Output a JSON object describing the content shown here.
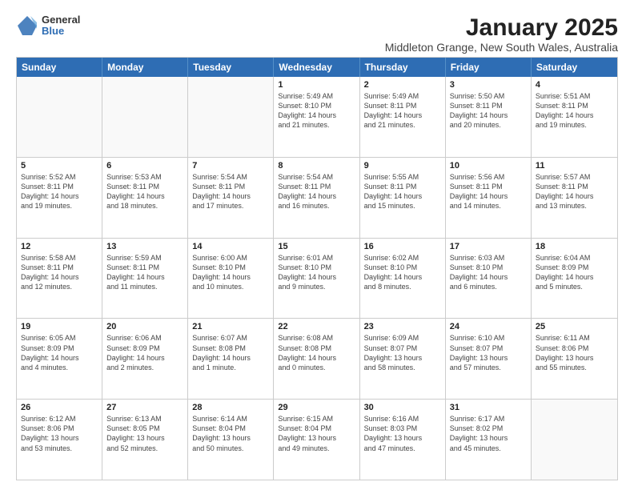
{
  "header": {
    "logo": {
      "general": "General",
      "blue": "Blue"
    },
    "title": "January 2025",
    "subtitle": "Middleton Grange, New South Wales, Australia"
  },
  "weekdays": [
    "Sunday",
    "Monday",
    "Tuesday",
    "Wednesday",
    "Thursday",
    "Friday",
    "Saturday"
  ],
  "rows": [
    [
      {
        "day": "",
        "info": "",
        "empty": true
      },
      {
        "day": "",
        "info": "",
        "empty": true
      },
      {
        "day": "",
        "info": "",
        "empty": true
      },
      {
        "day": "1",
        "info": "Sunrise: 5:49 AM\nSunset: 8:10 PM\nDaylight: 14 hours\nand 21 minutes."
      },
      {
        "day": "2",
        "info": "Sunrise: 5:49 AM\nSunset: 8:11 PM\nDaylight: 14 hours\nand 21 minutes."
      },
      {
        "day": "3",
        "info": "Sunrise: 5:50 AM\nSunset: 8:11 PM\nDaylight: 14 hours\nand 20 minutes."
      },
      {
        "day": "4",
        "info": "Sunrise: 5:51 AM\nSunset: 8:11 PM\nDaylight: 14 hours\nand 19 minutes."
      }
    ],
    [
      {
        "day": "5",
        "info": "Sunrise: 5:52 AM\nSunset: 8:11 PM\nDaylight: 14 hours\nand 19 minutes."
      },
      {
        "day": "6",
        "info": "Sunrise: 5:53 AM\nSunset: 8:11 PM\nDaylight: 14 hours\nand 18 minutes."
      },
      {
        "day": "7",
        "info": "Sunrise: 5:54 AM\nSunset: 8:11 PM\nDaylight: 14 hours\nand 17 minutes."
      },
      {
        "day": "8",
        "info": "Sunrise: 5:54 AM\nSunset: 8:11 PM\nDaylight: 14 hours\nand 16 minutes."
      },
      {
        "day": "9",
        "info": "Sunrise: 5:55 AM\nSunset: 8:11 PM\nDaylight: 14 hours\nand 15 minutes."
      },
      {
        "day": "10",
        "info": "Sunrise: 5:56 AM\nSunset: 8:11 PM\nDaylight: 14 hours\nand 14 minutes."
      },
      {
        "day": "11",
        "info": "Sunrise: 5:57 AM\nSunset: 8:11 PM\nDaylight: 14 hours\nand 13 minutes."
      }
    ],
    [
      {
        "day": "12",
        "info": "Sunrise: 5:58 AM\nSunset: 8:11 PM\nDaylight: 14 hours\nand 12 minutes."
      },
      {
        "day": "13",
        "info": "Sunrise: 5:59 AM\nSunset: 8:11 PM\nDaylight: 14 hours\nand 11 minutes."
      },
      {
        "day": "14",
        "info": "Sunrise: 6:00 AM\nSunset: 8:10 PM\nDaylight: 14 hours\nand 10 minutes."
      },
      {
        "day": "15",
        "info": "Sunrise: 6:01 AM\nSunset: 8:10 PM\nDaylight: 14 hours\nand 9 minutes."
      },
      {
        "day": "16",
        "info": "Sunrise: 6:02 AM\nSunset: 8:10 PM\nDaylight: 14 hours\nand 8 minutes."
      },
      {
        "day": "17",
        "info": "Sunrise: 6:03 AM\nSunset: 8:10 PM\nDaylight: 14 hours\nand 6 minutes."
      },
      {
        "day": "18",
        "info": "Sunrise: 6:04 AM\nSunset: 8:09 PM\nDaylight: 14 hours\nand 5 minutes."
      }
    ],
    [
      {
        "day": "19",
        "info": "Sunrise: 6:05 AM\nSunset: 8:09 PM\nDaylight: 14 hours\nand 4 minutes."
      },
      {
        "day": "20",
        "info": "Sunrise: 6:06 AM\nSunset: 8:09 PM\nDaylight: 14 hours\nand 2 minutes."
      },
      {
        "day": "21",
        "info": "Sunrise: 6:07 AM\nSunset: 8:08 PM\nDaylight: 14 hours\nand 1 minute."
      },
      {
        "day": "22",
        "info": "Sunrise: 6:08 AM\nSunset: 8:08 PM\nDaylight: 14 hours\nand 0 minutes."
      },
      {
        "day": "23",
        "info": "Sunrise: 6:09 AM\nSunset: 8:07 PM\nDaylight: 13 hours\nand 58 minutes."
      },
      {
        "day": "24",
        "info": "Sunrise: 6:10 AM\nSunset: 8:07 PM\nDaylight: 13 hours\nand 57 minutes."
      },
      {
        "day": "25",
        "info": "Sunrise: 6:11 AM\nSunset: 8:06 PM\nDaylight: 13 hours\nand 55 minutes."
      }
    ],
    [
      {
        "day": "26",
        "info": "Sunrise: 6:12 AM\nSunset: 8:06 PM\nDaylight: 13 hours\nand 53 minutes."
      },
      {
        "day": "27",
        "info": "Sunrise: 6:13 AM\nSunset: 8:05 PM\nDaylight: 13 hours\nand 52 minutes."
      },
      {
        "day": "28",
        "info": "Sunrise: 6:14 AM\nSunset: 8:04 PM\nDaylight: 13 hours\nand 50 minutes."
      },
      {
        "day": "29",
        "info": "Sunrise: 6:15 AM\nSunset: 8:04 PM\nDaylight: 13 hours\nand 49 minutes."
      },
      {
        "day": "30",
        "info": "Sunrise: 6:16 AM\nSunset: 8:03 PM\nDaylight: 13 hours\nand 47 minutes."
      },
      {
        "day": "31",
        "info": "Sunrise: 6:17 AM\nSunset: 8:02 PM\nDaylight: 13 hours\nand 45 minutes."
      },
      {
        "day": "",
        "info": "",
        "empty": true
      }
    ]
  ]
}
